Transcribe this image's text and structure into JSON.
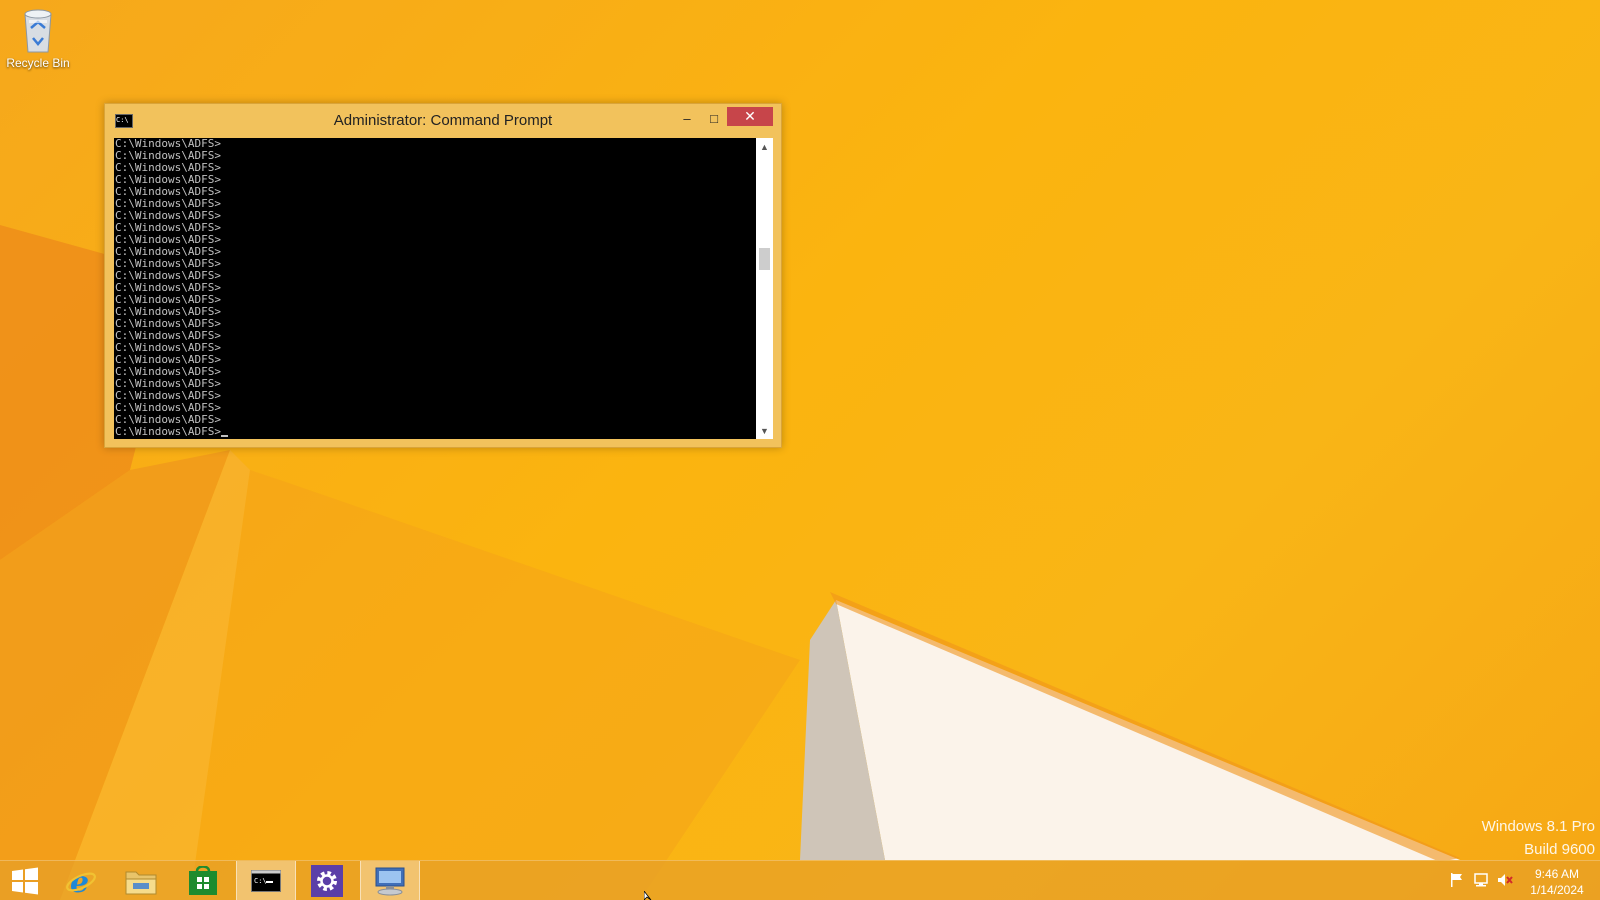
{
  "desktop": {
    "icons": [
      {
        "label": "Recycle Bin",
        "icon": "recycle-bin-icon"
      }
    ],
    "watermark": {
      "line1": "Windows 8.1 Pro",
      "line2": "Build 9600"
    }
  },
  "cmd_window": {
    "title": "Administrator: Command Prompt",
    "icon": "cmd-icon",
    "icon_text": "C:\\",
    "buttons": {
      "minimize": "–",
      "maximize": "□",
      "close": "✕"
    },
    "lines": [
      "C:\\Windows\\ADFS>",
      "C:\\Windows\\ADFS>",
      "C:\\Windows\\ADFS>",
      "C:\\Windows\\ADFS>",
      "C:\\Windows\\ADFS>",
      "C:\\Windows\\ADFS>",
      "C:\\Windows\\ADFS>",
      "C:\\Windows\\ADFS>",
      "C:\\Windows\\ADFS>",
      "C:\\Windows\\ADFS>",
      "C:\\Windows\\ADFS>",
      "C:\\Windows\\ADFS>",
      "C:\\Windows\\ADFS>",
      "C:\\Windows\\ADFS>",
      "C:\\Windows\\ADFS>",
      "C:\\Windows\\ADFS>",
      "C:\\Windows\\ADFS>",
      "C:\\Windows\\ADFS>",
      "C:\\Windows\\ADFS>",
      "C:\\Windows\\ADFS>",
      "C:\\Windows\\ADFS>",
      "C:\\Windows\\ADFS>",
      "C:\\Windows\\ADFS>",
      "C:\\Windows\\ADFS>",
      "C:\\Windows\\ADFS>"
    ],
    "scroll_position": 0.38,
    "colors": {
      "console_bg": "#000000",
      "console_fg": "#c0c0c0",
      "close_bg": "#c7454a"
    }
  },
  "taskbar": {
    "items": [
      {
        "name": "start-button",
        "icon": "windows-logo-icon"
      },
      {
        "name": "internet-explorer",
        "icon": "internet-explorer-icon"
      },
      {
        "name": "file-explorer",
        "icon": "folder-icon"
      },
      {
        "name": "windows-store",
        "icon": "store-icon"
      },
      {
        "name": "command-prompt",
        "icon": "cmd-icon",
        "active": true
      },
      {
        "name": "server-manager",
        "icon": "gear-icon"
      },
      {
        "name": "remote-desktop",
        "icon": "remote-computer-icon"
      }
    ],
    "tray": [
      "flag-icon",
      "network-icon",
      "speaker-muted-icon"
    ],
    "clock": {
      "time": "9:46 AM",
      "date": "1/14/2024"
    }
  }
}
